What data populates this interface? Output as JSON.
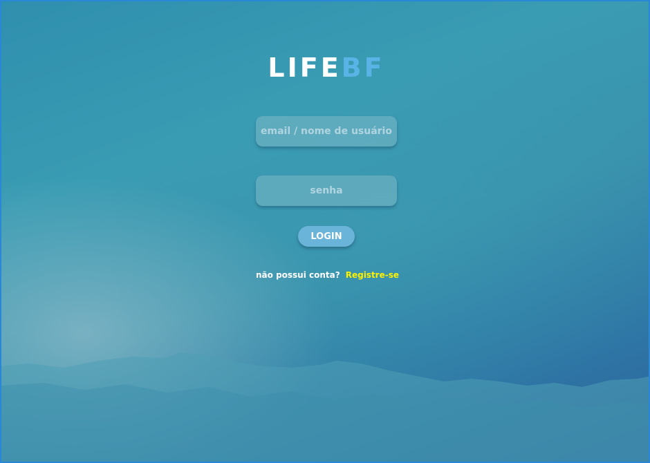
{
  "brand": {
    "part1": "LIFE",
    "part2": "BF"
  },
  "form": {
    "email_placeholder": "email / nome de usuário",
    "email_value": "",
    "password_placeholder": "senha",
    "password_value": "",
    "login_label": "LOGIN",
    "no_account_text": "não possui conta?",
    "register_label": "Registre-se"
  },
  "colors": {
    "brand_accent": "#5ab3e6",
    "register_link": "#fff200",
    "login_button": "#6bb4d9",
    "window_border": "#2a86d6"
  }
}
